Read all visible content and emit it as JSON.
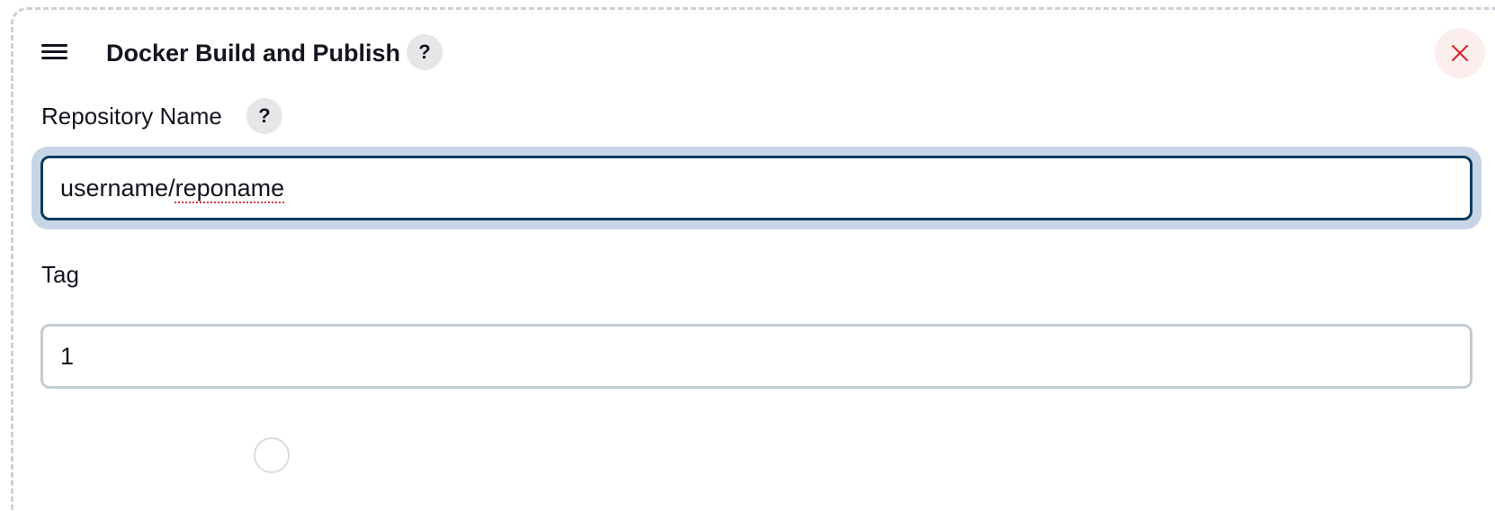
{
  "section": {
    "title": "Docker Build and Publish",
    "help_label": "?",
    "close_icon": "close-x-icon",
    "drag_icon": "hamburger-drag-icon"
  },
  "fields": {
    "repository": {
      "label": "Repository Name",
      "help_label": "?",
      "value_part1": "username/",
      "value_part2": "reponame"
    },
    "tag": {
      "label": "Tag",
      "value": "1"
    }
  },
  "colors": {
    "focus_border": "#0c3a5e",
    "focus_ring": "#c7d6e6",
    "close_bg": "#fdeeee",
    "close_icon": "#d9222a",
    "help_bg": "#e6e6e8",
    "dashed_border": "#c9d1d9"
  }
}
